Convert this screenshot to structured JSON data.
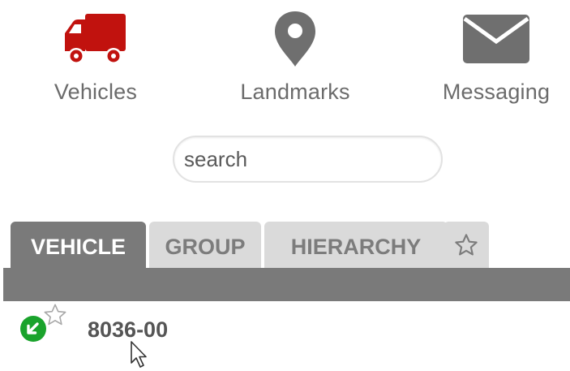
{
  "nav": {
    "vehicles": {
      "label": "Vehicles",
      "icon": "truck-icon",
      "color": "#c1120e"
    },
    "landmarks": {
      "label": "Landmarks",
      "icon": "map-pin-icon",
      "color": "#6f6f6f"
    },
    "messaging": {
      "label": "Messaging",
      "icon": "envelope-icon",
      "color": "#6f6f6f"
    }
  },
  "search": {
    "placeholder": "search",
    "value": ""
  },
  "tabs": [
    {
      "label": "VEHICLE",
      "active": true
    },
    {
      "label": "GROUP",
      "active": false
    },
    {
      "label": "HIERARCHY",
      "active": false
    },
    {
      "label": "",
      "icon": "star-icon",
      "active": false
    }
  ],
  "list": [
    {
      "name": "8036-00",
      "status": "moving",
      "status_color": "#1aa32c",
      "favorite": false
    }
  ]
}
